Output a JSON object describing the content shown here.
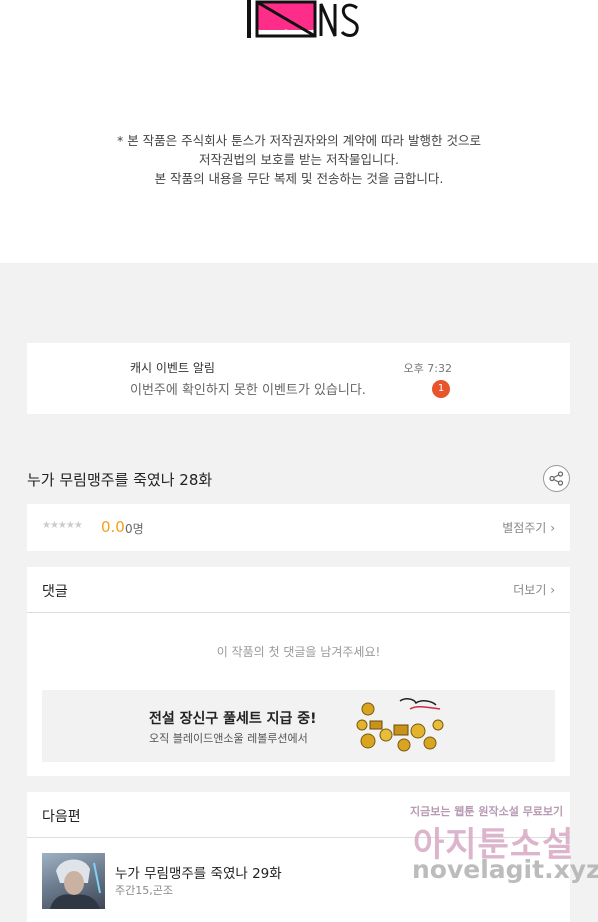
{
  "logo": {
    "text": "TOONS"
  },
  "notice": {
    "lines": [
      "* 본 작품은 주식회사 툰스가 저작권자와의 계약에 따라 발행한 것으로",
      "저작권법의 보호를 받는 저작물입니다.",
      "본 작품의 내용을 무단 복제 및 전송하는 것을 금합니다."
    ]
  },
  "event_notification": {
    "title": "캐시 이벤트 알림",
    "message": "이번주에 확인하지 못한 이벤트가 있습니다.",
    "time": "오후 7:32",
    "badge_count": "1",
    "badge_color": "#e8542e"
  },
  "episode": {
    "title": "누가 무림맹주를 죽였나 28화"
  },
  "rating": {
    "stars": "★★★★★",
    "score": "0.0",
    "count": "0명",
    "rate_link": "별점주기",
    "score_color": "#f0a11a"
  },
  "comments": {
    "title": "댓글",
    "more": "더보기",
    "empty_message": "이 작품의 첫 댓글을 남겨주세요!",
    "ad": {
      "title": "전설 장신구 풀세트 지급 중!",
      "subtitle": "오직 블레이드앤소울 레볼루션에서"
    }
  },
  "next_episode": {
    "section_title": "다음편",
    "title": "누가 무림맹주를 죽였나 29화",
    "meta": "주간15,곤조"
  },
  "watermark": {
    "top": "지금보는 웹툰 원작소설 무료보기",
    "main": "아지툰소설",
    "url": "novelagit.xyz"
  },
  "icons": {
    "share": "share-icon",
    "chevron": "chevron-right-icon"
  }
}
